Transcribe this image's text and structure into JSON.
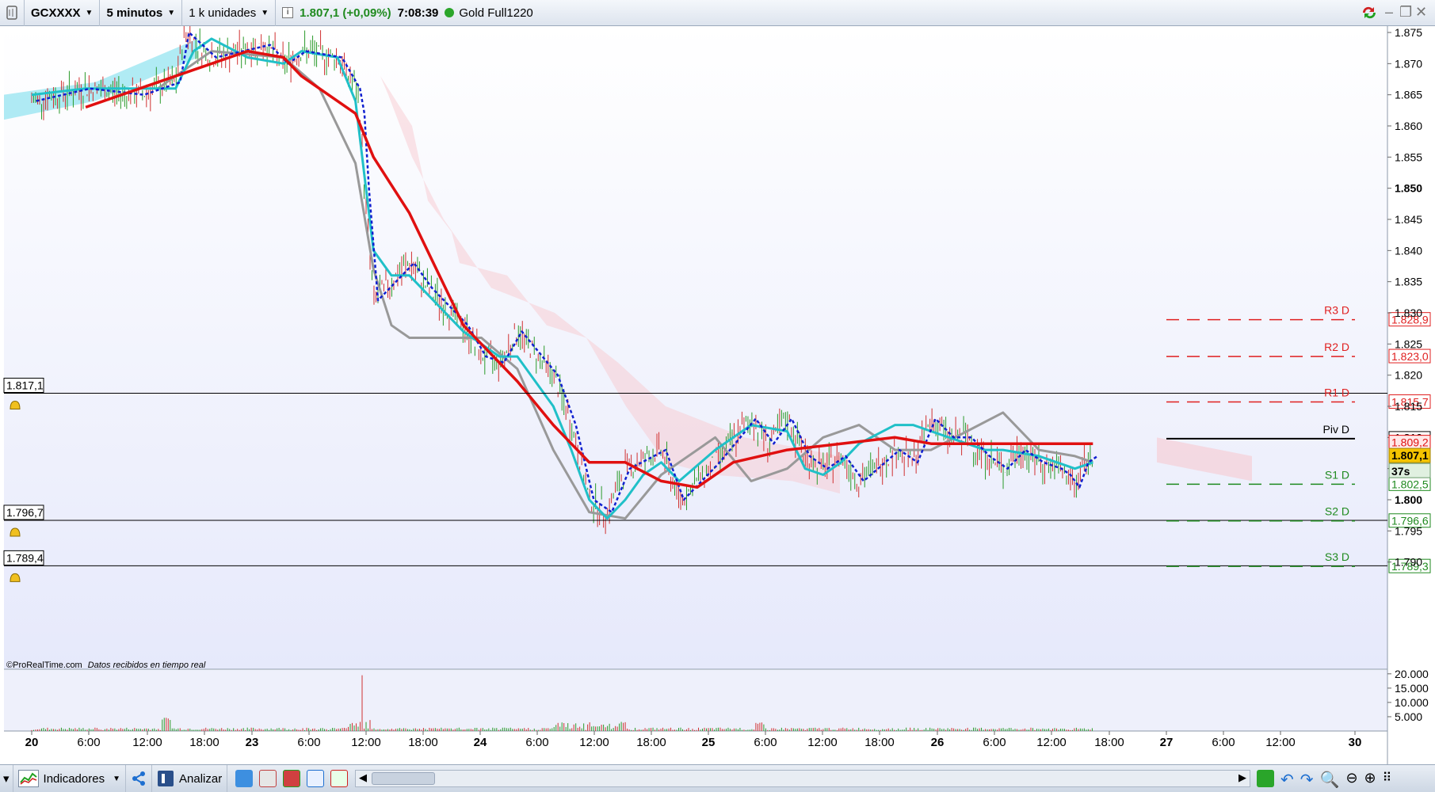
{
  "toolbar": {
    "symbol": "GCXXXX",
    "timeframe": "5 minutos",
    "units": "1 k unidades",
    "price_change": "1.807,1 (+0,09%)",
    "time": "7:08:39",
    "instrument_name": "Gold Full1220",
    "info_icon": "info-icon",
    "status_color": "#2aa52a"
  },
  "watermark": {
    "source": "©ProRealTime.com",
    "realtime_text": "Datos recibidos en tiempo real"
  },
  "price_axis": {
    "labels": [
      "1.875",
      "1.870",
      "1.865",
      "1.860",
      "1.855",
      "1.850",
      "1.845",
      "1.840",
      "1.835",
      "1.830",
      "1.825",
      "1.820",
      "1.815",
      "1.810",
      "1.805",
      "1.800",
      "1.795",
      "1.790"
    ],
    "bold_labels": [
      "1.850",
      "1.800"
    ]
  },
  "horizontal_lines": [
    {
      "label": "1.817,1"
    },
    {
      "label": "1.796,7"
    },
    {
      "label": "1.789,4"
    }
  ],
  "pivots": [
    {
      "name": "R3 D",
      "value": "1.828,9",
      "color": "#e02020"
    },
    {
      "name": "R2 D",
      "value": "1.823,0",
      "color": "#e02020"
    },
    {
      "name": "R1 D",
      "value": "1.815,7",
      "color": "#e02020"
    },
    {
      "name": "Piv D",
      "value": "1.809,8",
      "color": "#000000"
    },
    {
      "name": "S1 D",
      "value": "1.802,5",
      "color": "#1f8a1f"
    },
    {
      "name": "S2 D",
      "value": "1.796,6",
      "color": "#1f8a1f"
    },
    {
      "name": "S3 D",
      "value": "1.789,3",
      "color": "#1f8a1f"
    }
  ],
  "price_badges": {
    "red_ma": "1.809,2",
    "last_price": "1.807,1",
    "countdown": "37s"
  },
  "volume_axis": {
    "labels": [
      "20.000",
      "15.000",
      "10.000",
      "5.000"
    ]
  },
  "time_axis": {
    "labels": [
      "20",
      "6:00",
      "12:00",
      "18:00",
      "23",
      "6:00",
      "12:00",
      "18:00",
      "24",
      "6:00",
      "12:00",
      "18:00",
      "25",
      "6:00",
      "12:00",
      "18:00",
      "26",
      "6:00",
      "12:00",
      "18:00",
      "27",
      "6:00",
      "12:00",
      "30"
    ],
    "bold_labels": [
      "20",
      "23",
      "24",
      "25",
      "26",
      "27",
      "30"
    ]
  },
  "bottom_toolbar": {
    "indicators_label": "Indicadores",
    "analyze_label": "Analizar"
  },
  "colors": {
    "ma_red": "#e01010",
    "ma_cyan": "#20c0c8",
    "ma_gray": "#999999",
    "dotted_blue": "#1020d0",
    "cloud_cyan": "#8fe3f0",
    "cloud_pink": "#f7c9d0",
    "candle_green": "#2a9a2a",
    "candle_red": "#d03030"
  },
  "chart_data": {
    "type": "line",
    "title": "GCXXXX 5 minutos",
    "x_days": [
      "20",
      "23",
      "24",
      "25",
      "26",
      "27",
      "30"
    ],
    "ylim": [
      1789,
      1876
    ],
    "series": [
      {
        "name": "",
        "description": "price",
        "x_hours": [
          0,
          6,
          12,
          16,
          17,
          20,
          26,
          28,
          30,
          34,
          36,
          36.5,
          37,
          38,
          42,
          44,
          48,
          50,
          52,
          54,
          58,
          60,
          62,
          64,
          66,
          70,
          72,
          76,
          80,
          82,
          84,
          86,
          88,
          90,
          92,
          96,
          98,
          100,
          102,
          104,
          106,
          108,
          110,
          112,
          114,
          115,
          116,
          117,
          118
        ],
        "values": [
          1864,
          1866,
          1865,
          1867,
          1875,
          1871,
          1873,
          1870,
          1872,
          1871,
          1866,
          1862,
          1850,
          1832,
          1838,
          1834,
          1828,
          1823,
          1822,
          1827,
          1820,
          1812,
          1800,
          1798,
          1805,
          1808,
          1800,
          1806,
          1813,
          1809,
          1813,
          1807,
          1805,
          1807,
          1803,
          1808,
          1806,
          1813,
          1810,
          1810,
          1807,
          1805,
          1808,
          1806,
          1805,
          1804,
          1802,
          1806,
          1807
        ]
      },
      {
        "name": "",
        "description": "red moving average",
        "x_hours": [
          6,
          12,
          18,
          24,
          28,
          30,
          36,
          38,
          42,
          48,
          50,
          54,
          58,
          62,
          66,
          70,
          74,
          78,
          84,
          90,
          96,
          100,
          106,
          112,
          118
        ],
        "values": [
          1863,
          1866,
          1869,
          1872,
          1871,
          1868,
          1862,
          1855,
          1846,
          1828,
          1825,
          1819,
          1812,
          1806,
          1806,
          1803,
          1802,
          1806,
          1808,
          1809,
          1810,
          1809,
          1809,
          1809,
          1809
        ]
      },
      {
        "name": "",
        "description": "gray moving average",
        "x_hours": [
          14,
          20,
          28,
          32,
          36,
          38,
          40,
          42,
          46,
          50,
          54,
          58,
          62,
          66,
          70,
          76,
          80,
          84,
          88,
          92,
          96,
          100,
          104,
          108,
          112,
          116,
          118
        ],
        "values": [
          1866,
          1872,
          1871,
          1866,
          1854,
          1837,
          1828,
          1826,
          1826,
          1826,
          1821,
          1808,
          1798,
          1797,
          1804,
          1810,
          1803,
          1805,
          1810,
          1812,
          1808,
          1808,
          1811,
          1814,
          1808,
          1807,
          1806
        ]
      }
    ]
  }
}
